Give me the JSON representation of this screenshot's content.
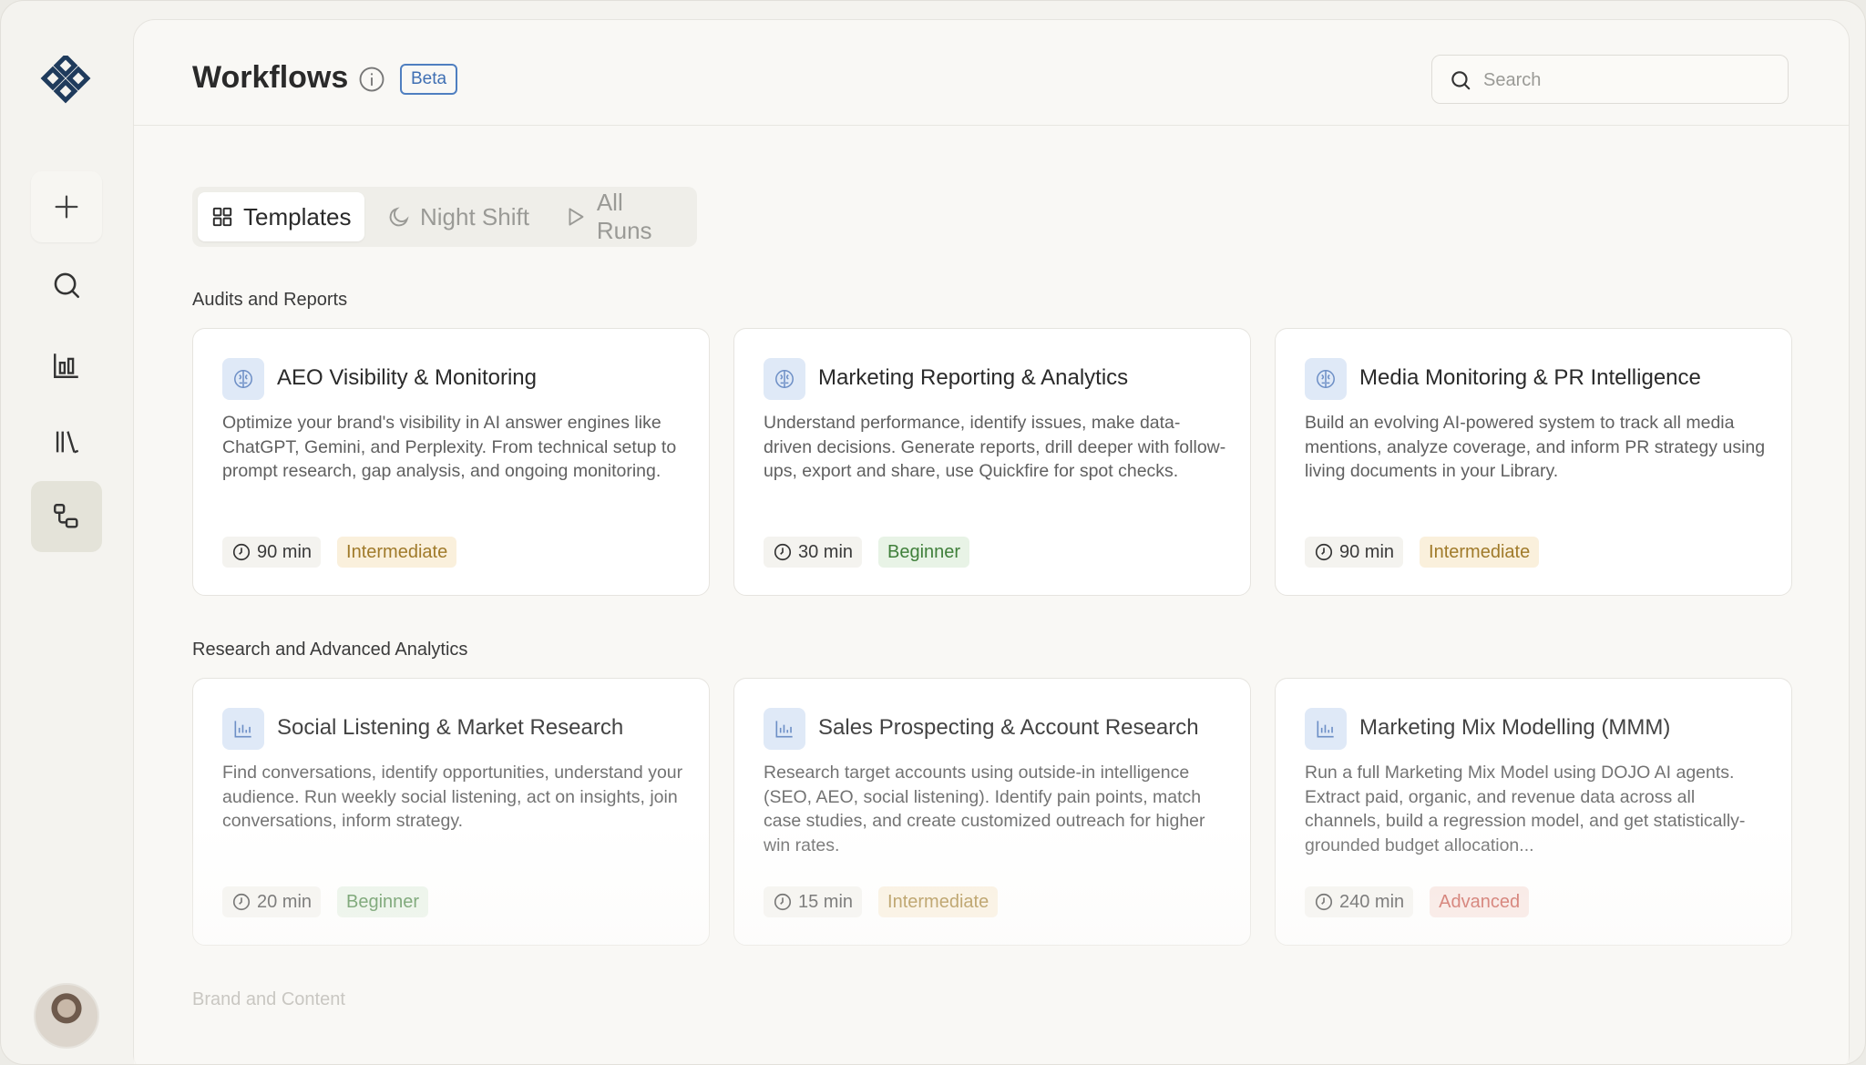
{
  "app": {
    "logo": "diamond-grid-logo",
    "nav": [
      {
        "name": "new",
        "icon": "plus-icon"
      },
      {
        "name": "search",
        "icon": "search-icon"
      },
      {
        "name": "analytics",
        "icon": "bar-chart-icon"
      },
      {
        "name": "library",
        "icon": "library-icon"
      },
      {
        "name": "workflows",
        "icon": "workflow-icon",
        "active": true
      }
    ]
  },
  "header": {
    "title": "Workflows",
    "badge": "Beta",
    "search_placeholder": "Search"
  },
  "tabs": [
    {
      "label": "Templates",
      "icon": "grid-icon",
      "active": true
    },
    {
      "label": "Night Shift",
      "icon": "moon-icon"
    },
    {
      "label": "All Runs",
      "icon": "play-icon"
    }
  ],
  "sections": [
    {
      "title": "Audits and Reports",
      "cards": [
        {
          "title": "AEO Visibility & Monitoring",
          "icon": "brain-icon",
          "description": "Optimize your brand's visibility in AI answer engines like ChatGPT, Gemini, and Perplexity. From technical setup to prompt research, gap analysis, and ongoing monitoring.",
          "duration": "90 min",
          "level": "Intermediate"
        },
        {
          "title": "Marketing Reporting & Analytics",
          "icon": "brain-icon",
          "description": "Understand performance, identify issues, make data-driven decisions. Generate reports, drill deeper with follow-ups, export and share, use Quickfire for spot checks.",
          "duration": "30 min",
          "level": "Beginner"
        },
        {
          "title": "Media Monitoring & PR Intelligence",
          "icon": "brain-icon",
          "description": "Build an evolving AI-powered system to track all media mentions, analyze coverage, and inform PR strategy using living documents in your Library.",
          "duration": "90 min",
          "level": "Intermediate"
        }
      ]
    },
    {
      "title": "Research and Advanced Analytics",
      "cards": [
        {
          "title": "Social Listening & Market Research",
          "icon": "chart-icon",
          "description": "Find conversations, identify opportunities, understand your audience. Run weekly social listening, act on insights, join conversations, inform strategy.",
          "duration": "20 min",
          "level": "Beginner"
        },
        {
          "title": "Sales Prospecting & Account Research",
          "icon": "chart-icon",
          "description": "Research target accounts using outside-in intelligence (SEO, AEO, social listening). Identify pain points, match case studies, and create customized outreach for higher win rates.",
          "duration": "15 min",
          "level": "Intermediate"
        },
        {
          "title": "Marketing Mix Modelling (MMM)",
          "icon": "chart-icon",
          "description": "Run a full Marketing Mix Model using DOJO AI agents. Extract paid, organic, and revenue data across all channels, build a regression model, and get statistically-grounded budget allocation...",
          "duration": "240 min",
          "level": "Advanced"
        }
      ]
    },
    {
      "title": "Brand and Content",
      "cards": []
    }
  ]
}
